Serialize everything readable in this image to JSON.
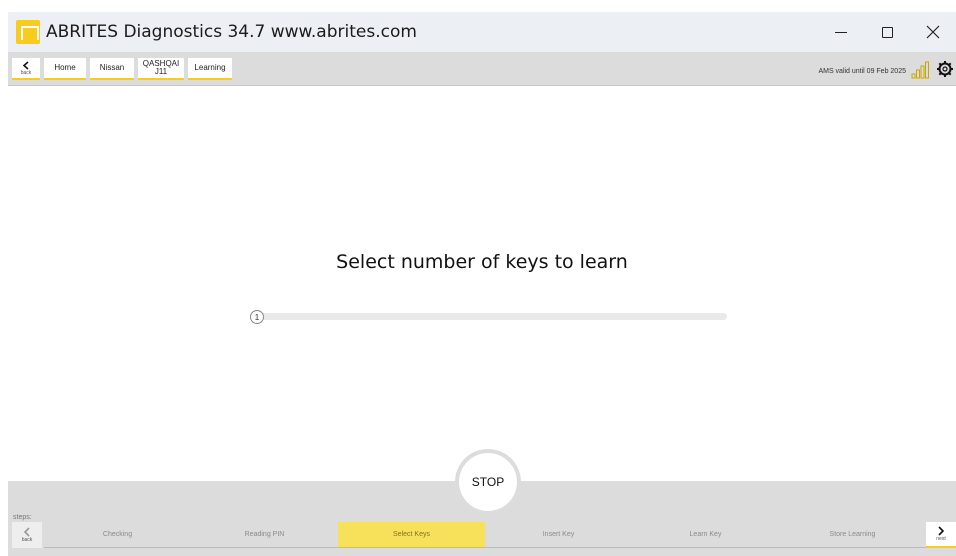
{
  "window": {
    "title": "ABRITES Diagnostics 34.7   www.abrites.com",
    "minimize_icon": "minimize-icon",
    "maximize_icon": "maximize-icon",
    "close_icon": "close-icon"
  },
  "nav": {
    "back_label": "back",
    "crumbs": [
      {
        "label": "Home"
      },
      {
        "label": "Nissan"
      },
      {
        "label": "QASHQAI\nJ11"
      },
      {
        "label": "Learning"
      }
    ],
    "license_status": "AMS valid until 09 Feb 2025",
    "signal_icon": "signal-strength-icon",
    "settings_icon": "gear-icon",
    "accent_color": "#f7cc1e"
  },
  "main": {
    "headline": "Select number of keys to learn",
    "slider": {
      "value": 1,
      "min": 1
    }
  },
  "bottom": {
    "stop_label": "STOP",
    "steps_label": "steps:",
    "back_label": "back",
    "next_label": "next",
    "steps": [
      {
        "label": "Checking",
        "active": false
      },
      {
        "label": "Reading PIN",
        "active": false
      },
      {
        "label": "Select Keys",
        "active": true
      },
      {
        "label": "Insert Key",
        "active": false
      },
      {
        "label": "Learn Key",
        "active": false
      },
      {
        "label": "Store Learning",
        "active": false
      }
    ],
    "active_step_color": "#f7e05a"
  }
}
